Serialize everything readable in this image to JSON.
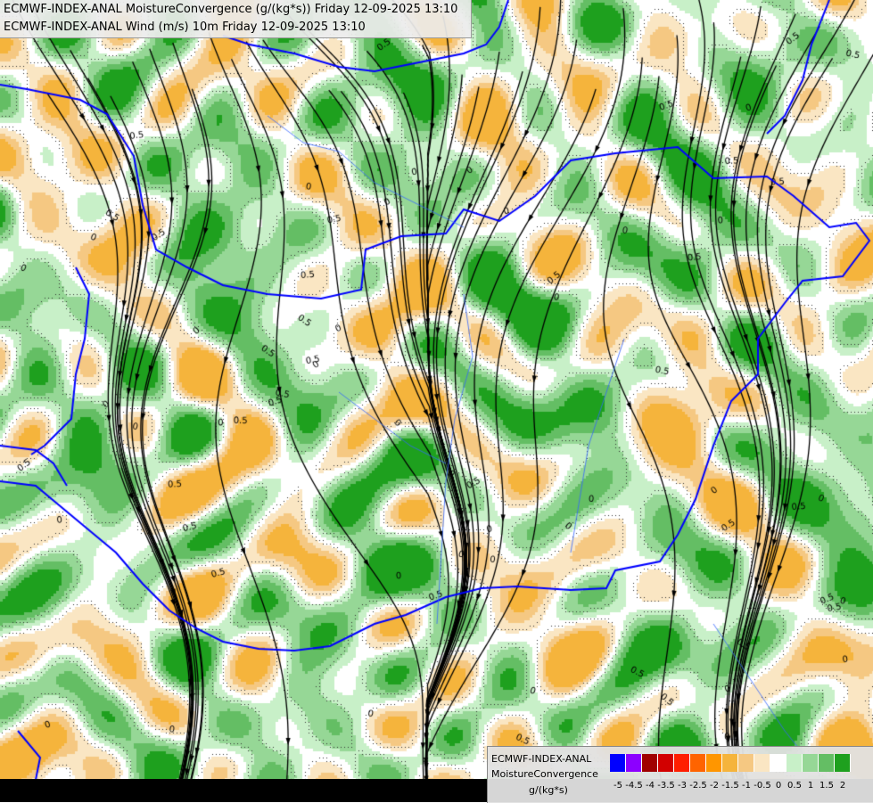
{
  "title": {
    "line1": "ECMWF-INDEX-ANAL MoistureConvergence (g/(kg*s)) Friday 12-09-2025 13:10",
    "line2": "ECMWF-INDEX-ANAL Wind (m/s) 10m Friday 12-09-2025 13:10"
  },
  "legend": {
    "model": "ECMWF-INDEX-ANAL",
    "variable": "MoistureConvergence",
    "unit": "g/(kg*s)",
    "levels": [
      {
        "label": "-5",
        "color": "#0000ff"
      },
      {
        "label": "-4.5",
        "color": "#8c00ff"
      },
      {
        "label": "-4",
        "color": "#a00000"
      },
      {
        "label": "-3.5",
        "color": "#d20000"
      },
      {
        "label": "-3",
        "color": "#ff1e00"
      },
      {
        "label": "-2.5",
        "color": "#ff6400"
      },
      {
        "label": "-2",
        "color": "#ff9600"
      },
      {
        "label": "-1.5",
        "color": "#f5b43c"
      },
      {
        "label": "-1",
        "color": "#f5c882"
      },
      {
        "label": "-0.5",
        "color": "#fae6c3"
      },
      {
        "label": "0",
        "color": "#ffffff"
      },
      {
        "label": "0.5",
        "color": "#c8f0c8"
      },
      {
        "label": "1",
        "color": "#96d796"
      },
      {
        "label": "1.5",
        "color": "#64be64"
      },
      {
        "label": "2",
        "color": "#1ea01e"
      }
    ]
  },
  "map": {
    "contour_labels": [
      "0",
      "0.5",
      "-0.5"
    ],
    "colors": {
      "border": "#0000ff",
      "river": "#3366ff",
      "streamline": "#000000",
      "no_data": "#000000"
    }
  }
}
